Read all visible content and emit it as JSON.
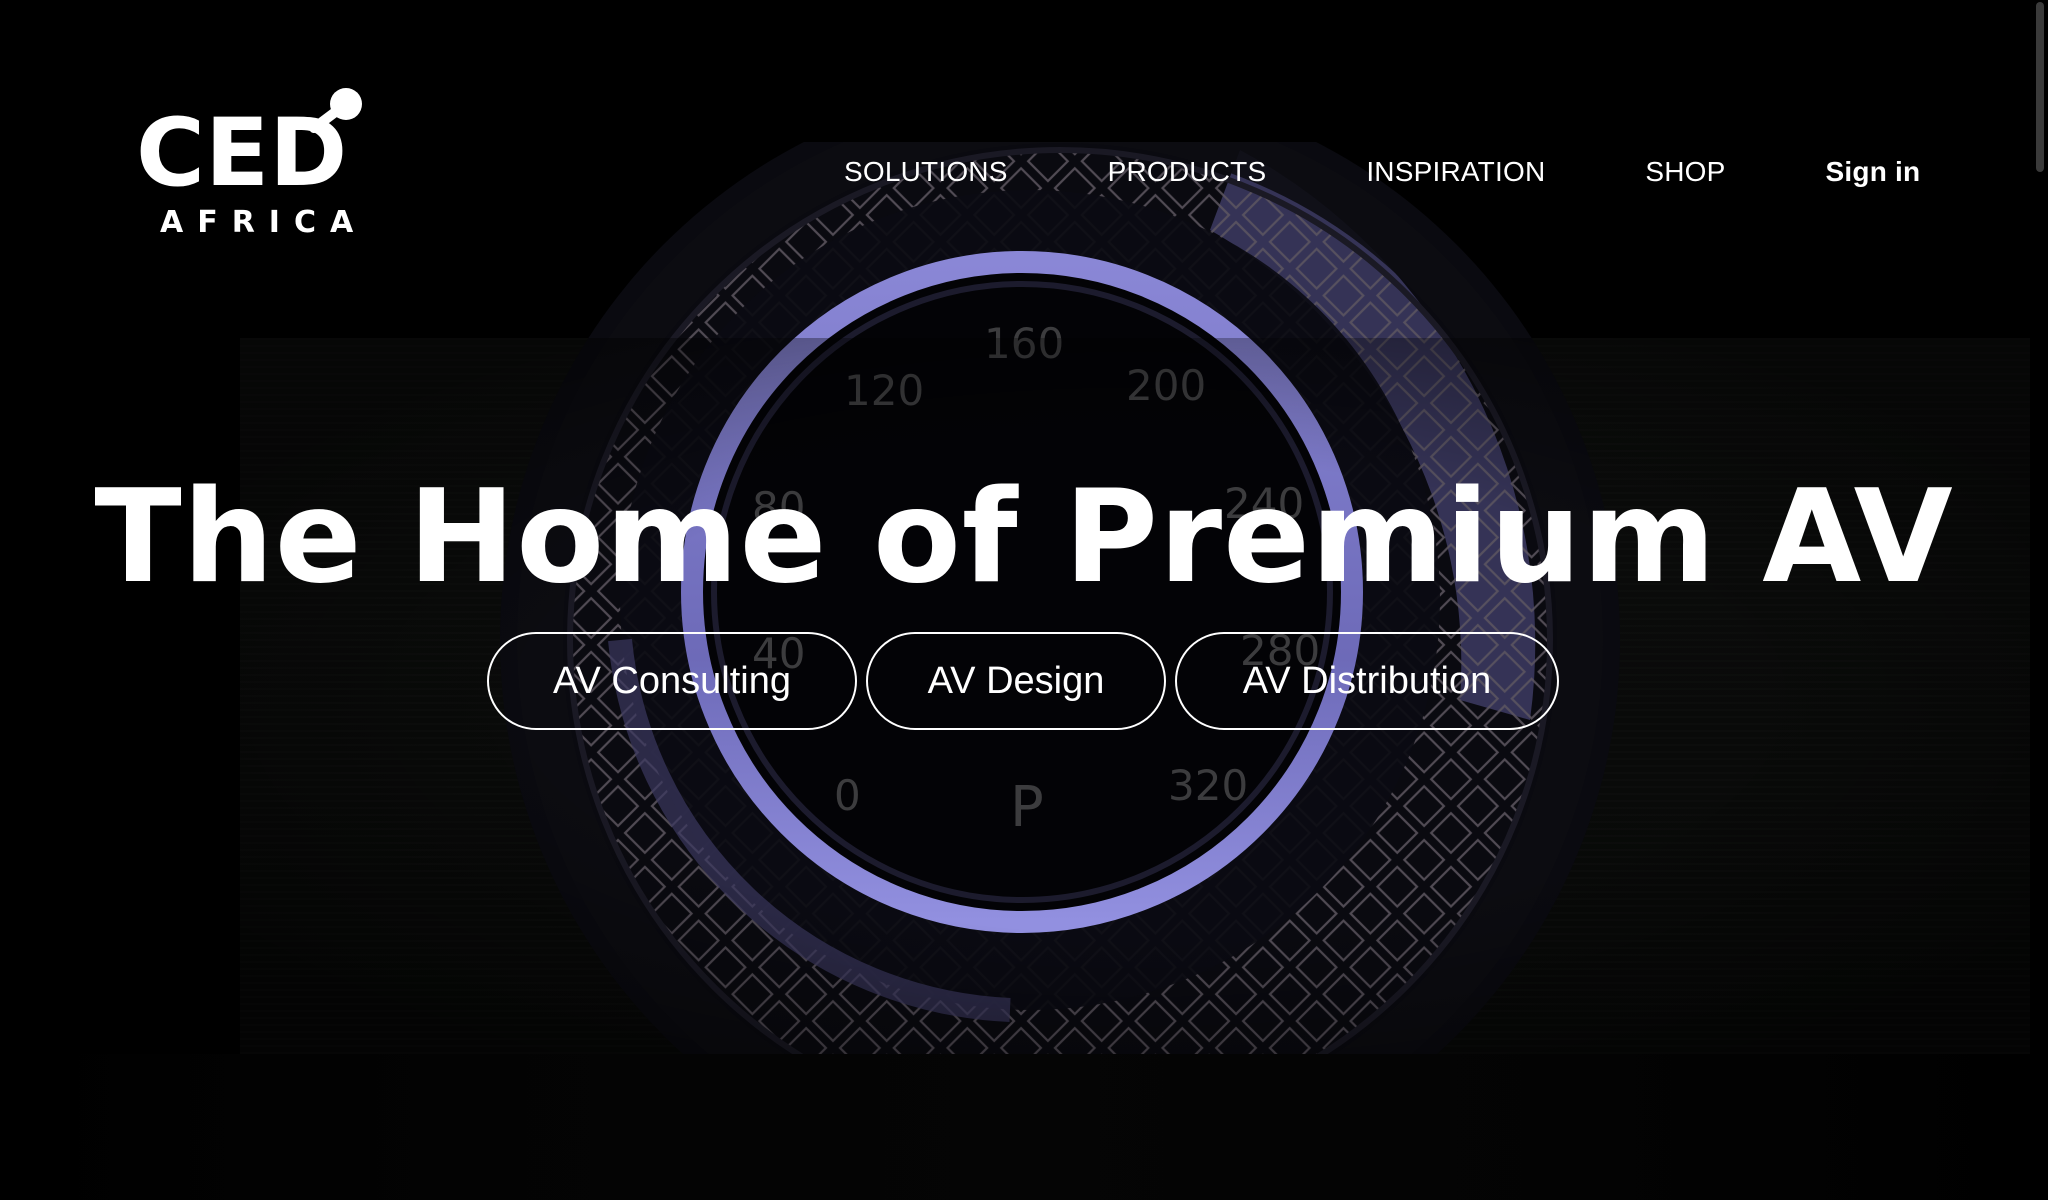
{
  "brand": {
    "logo_text": "CED",
    "logo_subtext": "AFRICA"
  },
  "nav": {
    "items": [
      {
        "label": "SOLUTIONS"
      },
      {
        "label": "PRODUCTS"
      },
      {
        "label": "INSPIRATION"
      },
      {
        "label": "SHOP"
      }
    ],
    "signin_label": "Sign in"
  },
  "hero": {
    "headline": "The Home of Premium AV",
    "buttons": [
      {
        "label": "AV Consulting"
      },
      {
        "label": "AV Design"
      },
      {
        "label": "AV Distribution"
      }
    ],
    "background_gauge_numbers": [
      "120",
      "160",
      "200",
      "80",
      "240",
      "40",
      "280",
      "0",
      "P",
      "320"
    ]
  },
  "colors": {
    "background": "#000000",
    "text": "#ffffff",
    "ring_accent": "#7b78c8"
  }
}
